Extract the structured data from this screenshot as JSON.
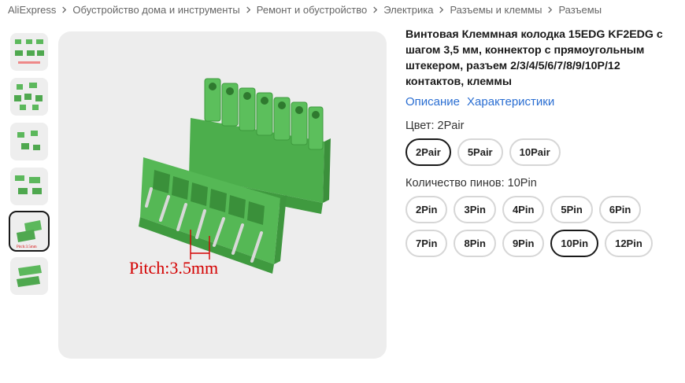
{
  "breadcrumb": [
    "AliExpress",
    "Обустройство дома и инструменты",
    "Ремонт и обустройство",
    "Электрика",
    "Разъемы и клеммы",
    "Разъемы"
  ],
  "gallery": {
    "thumbnail_count": 6,
    "selected_index": 4,
    "main_image_caption": "Pitch:3.5mm"
  },
  "product": {
    "title": "Винтовая Клеммная колодка 15EDG KF2EDG с шагом 3,5 мм, коннектор с прямоугольным штекером, разъем 2/3/4/5/6/7/8/9/10P/12 контактов, клеммы",
    "link_description": "Описание",
    "link_specs": "Характеристики"
  },
  "color": {
    "label": "Цвет: 2Pair",
    "options": [
      "2Pair",
      "5Pair",
      "10Pair"
    ],
    "selected": "2Pair"
  },
  "pins": {
    "label": "Количество пинов: 10Pin",
    "options": [
      "2Pin",
      "3Pin",
      "4Pin",
      "5Pin",
      "6Pin",
      "7Pin",
      "8Pin",
      "9Pin",
      "10Pin",
      "12Pin"
    ],
    "selected": "10Pin"
  },
  "colors": {
    "accent_link": "#2a6ed2",
    "connector_green": "#5cb85c",
    "caption_red": "#d40000"
  }
}
